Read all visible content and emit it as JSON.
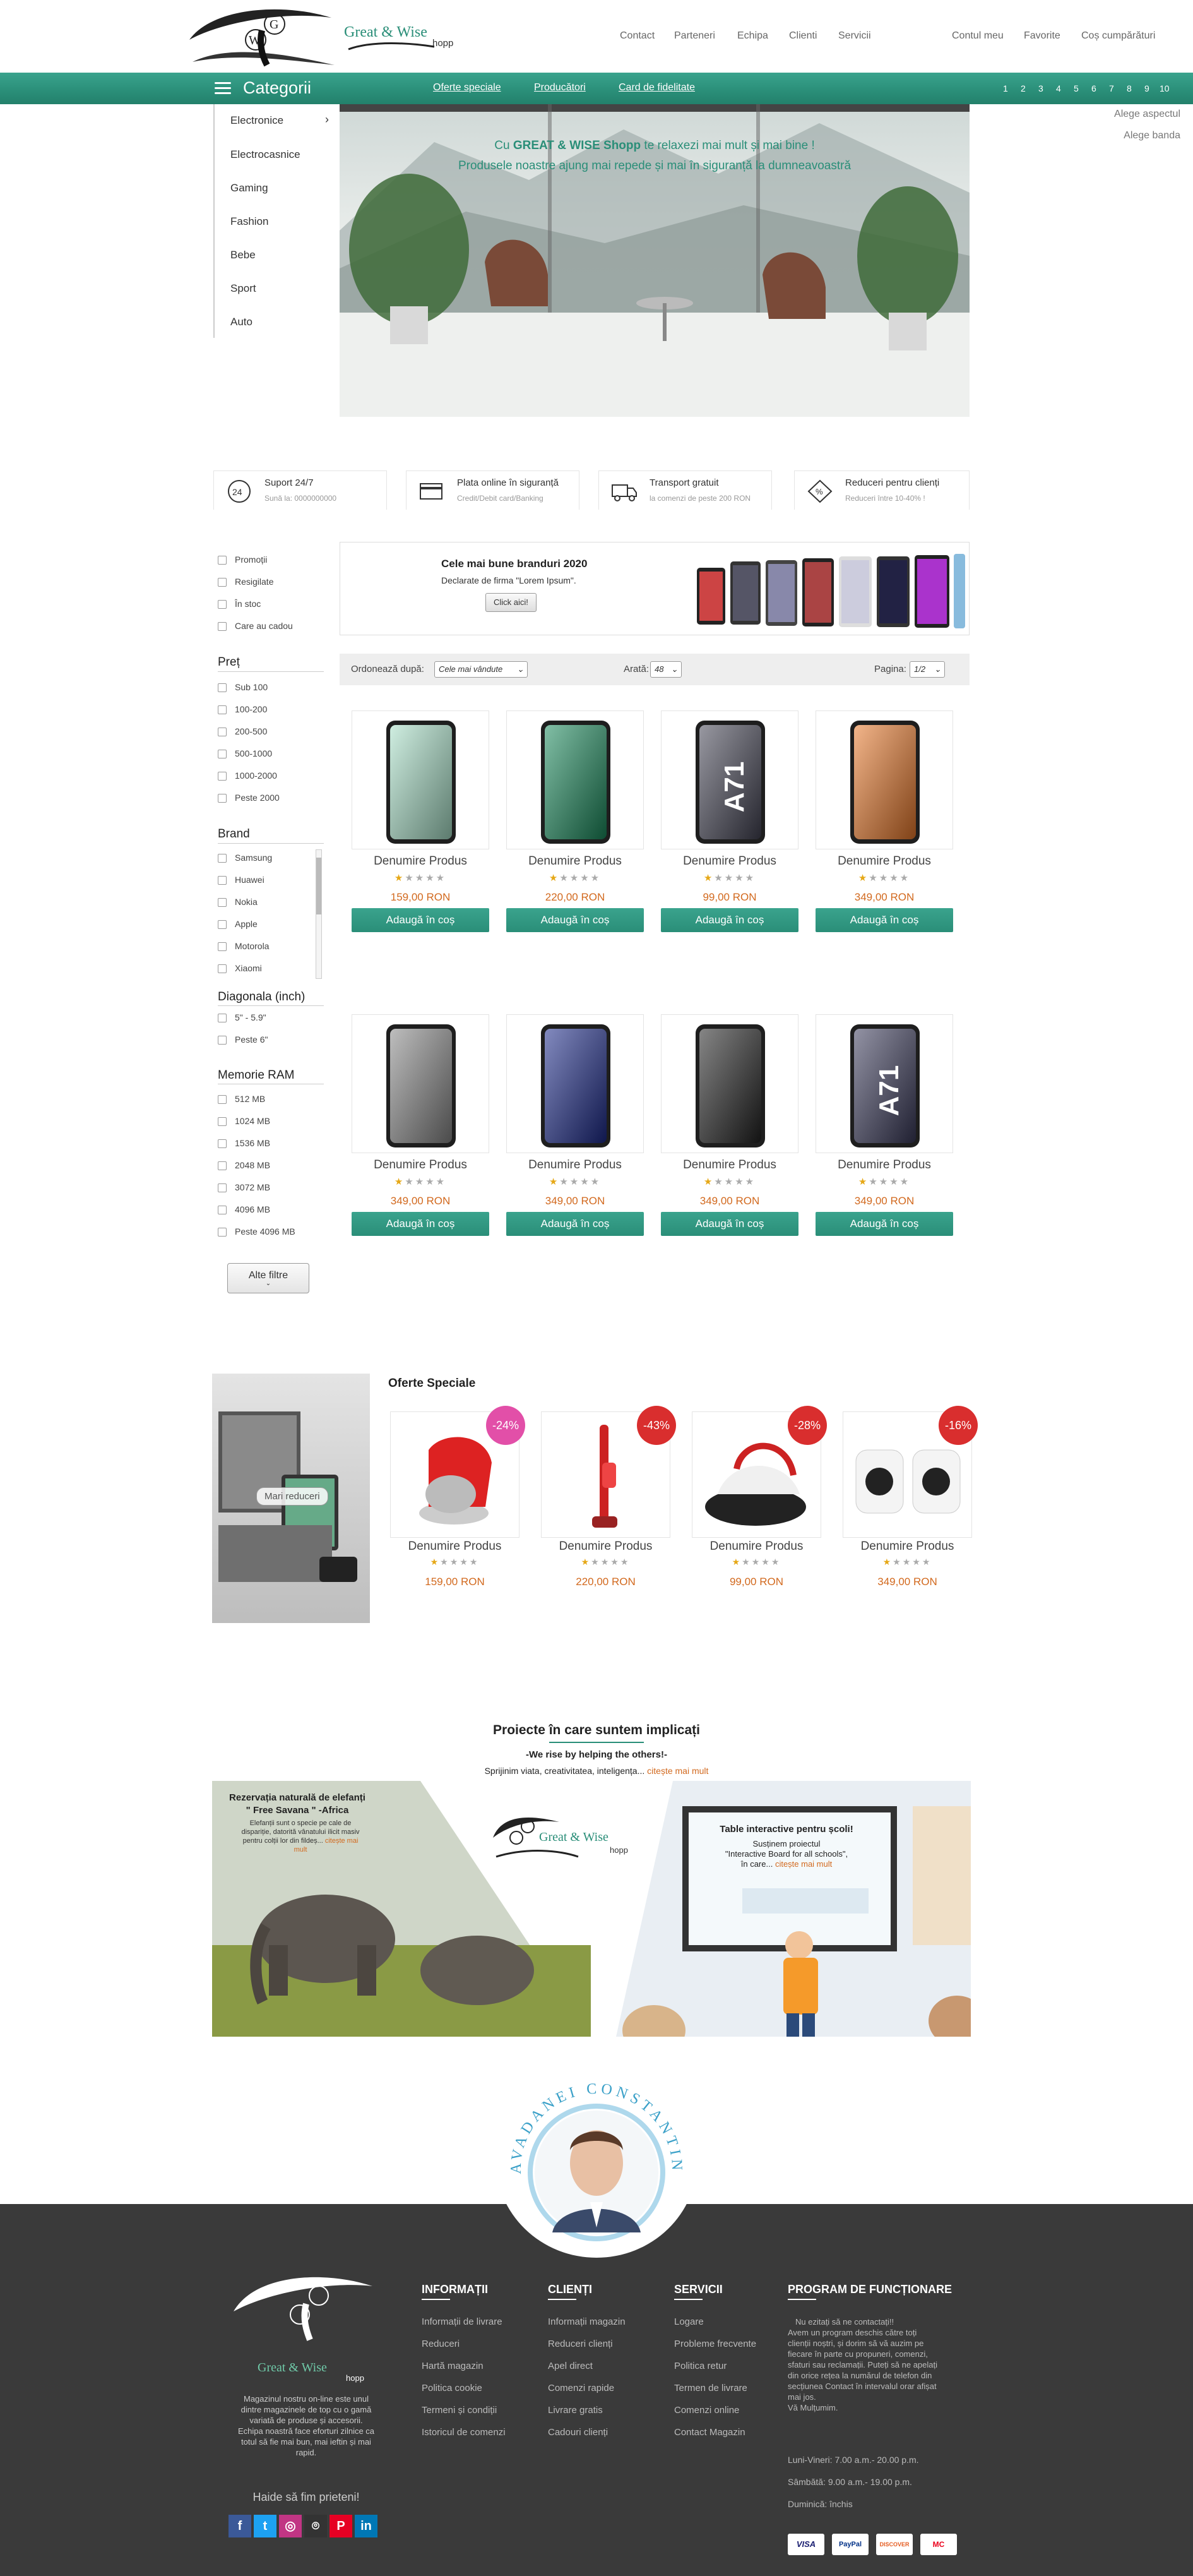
{
  "header": {
    "logo_text": "Great & Wise",
    "logo_sub": "hopp",
    "nav": [
      "Contact",
      "Parteneri",
      "Echipa",
      "Clienti",
      "Servicii"
    ],
    "account_nav": [
      "Contul meu",
      "Favorite",
      "Coș cumpărături"
    ]
  },
  "catbar": {
    "title": "Categorii",
    "links": [
      "Oferte speciale",
      "Producători",
      "Card de fidelitate"
    ],
    "pages": [
      "1",
      "2",
      "3",
      "4",
      "5",
      "6",
      "7",
      "8",
      "9",
      "10"
    ]
  },
  "sidebar_categories": [
    "Electronice",
    "Electrocasnice",
    "Gaming",
    "Fashion",
    "Bebe",
    "Sport",
    "Auto"
  ],
  "side_links": [
    "Alege aspectul",
    "Alege banda"
  ],
  "hero": {
    "line1_pre": "Cu ",
    "line1_brand": "GREAT & WISE Shopp",
    "line1_post": " te relaxezi mai mult și mai bine !",
    "line2": "Produsele noastre ajung mai repede și mai în siguranță la dumneavoastră"
  },
  "features": [
    {
      "title": "Suport 24/7",
      "sub": "Sună la: 0000000000",
      "icon": "support-24-icon"
    },
    {
      "title": "Plata online în siguranță",
      "sub": "Credit/Debit card/Banking",
      "icon": "card-payment-icon"
    },
    {
      "title": "Transport gratuit",
      "sub": "la comenzi de peste 200 RON",
      "icon": "truck-icon"
    },
    {
      "title": "Reduceri pentru clienți",
      "sub": "Reduceri între 10-40% !",
      "icon": "discount-tag-icon"
    }
  ],
  "filters": {
    "general": [
      "Promoții",
      "Resigilate",
      "În stoc",
      "Care au cadou"
    ],
    "price_title": "Preț",
    "price": [
      "Sub 100",
      "100-200",
      "200-500",
      "500-1000",
      "1000-2000",
      "Peste 2000"
    ],
    "brand_title": "Brand",
    "brand": [
      "Samsung",
      "Huawei",
      "Nokia",
      "Apple",
      "Motorola",
      "Xiaomi"
    ],
    "diag_title": "Diagonala (inch)",
    "diag": [
      "5\" - 5.9\"",
      "Peste 6\""
    ],
    "ram_title": "Memorie RAM",
    "ram": [
      "512 MB",
      "1024 MB",
      "1536 MB",
      "2048 MB",
      "3072 MB",
      "4096 MB",
      "Peste 4096 MB"
    ],
    "more_button": "Alte filtre"
  },
  "brand_banner": {
    "title": "Cele mai bune branduri 2020",
    "sub": "Declarate de firma \"Lorem Ipsum\".",
    "button": "Click aici!"
  },
  "sortbar": {
    "order_label": "Ordonează după:",
    "order_value": "Cele mai vândute",
    "show_label": "Arată:",
    "show_value": "48",
    "page_label": "Pagina:",
    "page_value": "1/2"
  },
  "products": [
    {
      "name": "Denumire Produs",
      "price": "159,00 RON",
      "rating": 1,
      "phone_color": "#a8e0c8",
      "label": ""
    },
    {
      "name": "Denumire Produs",
      "price": "220,00 RON",
      "rating": 1,
      "phone_color": "#1a8a5c",
      "label": ""
    },
    {
      "name": "Denumire Produs",
      "price": "99,00 RON",
      "rating": 1,
      "phone_color": "#444454",
      "label": "A71"
    },
    {
      "name": "Denumire Produs",
      "price": "349,00 RON",
      "rating": 1,
      "phone_color": "#e8782a",
      "label": ""
    },
    {
      "name": "Denumire Produs",
      "price": "349,00 RON",
      "rating": 1,
      "phone_color": "#888888",
      "label": ""
    },
    {
      "name": "Denumire Produs",
      "price": "349,00 RON",
      "rating": 1,
      "phone_color": "#1c2a8a",
      "label": ""
    },
    {
      "name": "Denumire Produs",
      "price": "349,00 RON",
      "rating": 1,
      "phone_color": "#222222",
      "label": ""
    },
    {
      "name": "Denumire Produs",
      "price": "349,00 RON",
      "rating": 1,
      "phone_color": "#3a3a5a",
      "label": "A71"
    }
  ],
  "add_to_cart": "Adaugă în coș",
  "specials": {
    "title": "Oferte Speciale",
    "side_button": "Mari reduceri",
    "items": [
      {
        "name": "Denumire Produs",
        "price": "159,00 RON",
        "badge": "-24%",
        "badge_color": "#e24fa8"
      },
      {
        "name": "Denumire Produs",
        "price": "220,00 RON",
        "badge": "-43%",
        "badge_color": "#d92e2e"
      },
      {
        "name": "Denumire Produs",
        "price": "99,00 RON",
        "badge": "-28%",
        "badge_color": "#d92e2e"
      },
      {
        "name": "Denumire Produs",
        "price": "349,00 RON",
        "badge": "-16%",
        "badge_color": "#d92e2e"
      }
    ]
  },
  "projects": {
    "title": "Proiecte în care suntem implicați",
    "tagline": "-We rise by helping the others!-",
    "desc_pre": "Sprijinim viata, creativitatea, inteligența... ",
    "desc_link": "citește mai mult",
    "left_title1": "Rezervația naturală de elefanți",
    "left_title2": "\" Free Savana \" -Africa",
    "left_text": "Elefanții sunt o specie pe cale de dispariție, datorită vânatului ilicit masiv pentru colții lor din fildeș...",
    "left_link": "citește mai mult",
    "right_title": "Table interactive pentru școli!",
    "right_text1": "Susținem proiectul",
    "right_text2": "\"Interactive Board for all schools\",",
    "right_text3": "în care...",
    "right_link": "citește mai mult",
    "center_logo_text": "Great & Wise",
    "center_logo_sub": "hopp"
  },
  "founder": {
    "name": "AVADANEI CONSTANTIN"
  },
  "footer": {
    "logo_text": "Great & Wise",
    "logo_sub": "hopp",
    "about_lines": [
      "Magazinul nostru on-line este unul",
      "dintre magazinele de top cu o gamă",
      "variată de produse și accesorii.",
      "Echipa noastră face eforturi zilnice ca",
      "totul să fie mai bun, mai ieftin și mai",
      "rapid."
    ],
    "social_title": "Haide să fim prieteni!",
    "col1_title": "INFORMAȚII",
    "col1": [
      "Informații de livrare",
      "Reduceri",
      "Hartă magazin",
      "Politica cookie",
      "Termeni și condiții",
      "Istoricul de comenzi"
    ],
    "col2_title": "CLIENȚI",
    "col2": [
      "Informații magazin",
      "Reduceri clienți",
      "Apel direct",
      "Comenzi rapide",
      "Livrare gratis",
      "Cadouri clienți"
    ],
    "col3_title": "SERVICII",
    "col3": [
      "Logare",
      "Probleme frecvente",
      "Politica retur",
      "Termen de livrare",
      "Comenzi online",
      "Contact Magazin"
    ],
    "col4_title": "PROGRAM DE FUNCȚIONARE",
    "col4_intro": [
      "Nu ezitați să ne contactați!!",
      "Avem un program deschis către toți",
      "clienții noștri, și dorim să vă auzim pe",
      "fiecare în parte cu propuneri, comenzi,",
      "sfaturi sau reclamații. Puteți să ne apelați",
      "din orice rețea la numărul de telefon din",
      "secțiunea Contact în intervalul orar afișat",
      "mai jos.",
      "Vă Mulțumim."
    ],
    "hours": [
      "Luni-Vineri: 7.00 a.m.- 20.00 p.m.",
      "Sâmbătă: 9.00 a.m.- 19.00 p.m.",
      "Duminică: închis"
    ],
    "social": [
      "f",
      "t",
      "◎",
      "⌾",
      "P",
      "in"
    ],
    "payments": [
      "VISA",
      "PayPal",
      "DISCOVER",
      "MC"
    ]
  },
  "colors": {
    "brand_green": "#2a8e78",
    "price_orange": "#d2691e",
    "footer_bg": "#3a3a3a"
  }
}
